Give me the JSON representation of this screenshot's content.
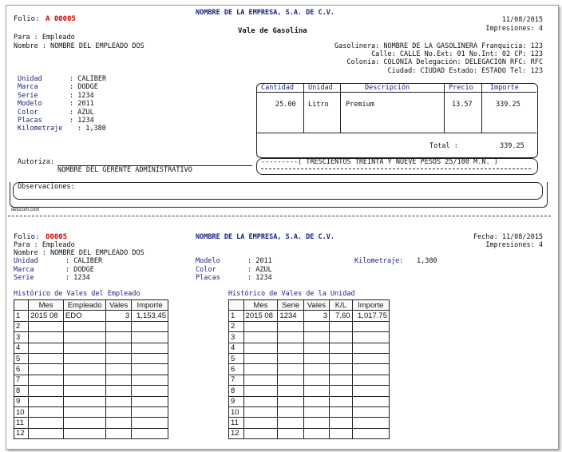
{
  "voucher": {
    "folio_label": "Folio:",
    "folio_value": "A 00005",
    "company": "NOMBRE DE LA EMPRESA, S.A. DE C.V.",
    "title": "Vale de Gasolina",
    "date": "11/08/2015",
    "impressions": "Impresiones: 4",
    "para_label": "Para   : Empleado",
    "nombre_label": "Nombre : NOMBRE DEL EMPLEADO DOS",
    "station": [
      "Gasolinera: NOMBRE DE LA GASOLINERA Franquicia: 123",
      "Calle: CALLE No.Ext: 01 No.Int: 02 CP: 123",
      "Colonia: COLONIA Delegación: DELEGACION  RFC: RFC",
      "Ciudad: CIUDAD Estado: ESTADO Tel: 123"
    ],
    "vehicle": [
      {
        "label": "Unidad",
        "value": ": CALIBER"
      },
      {
        "label": "Marca",
        "value": ": DODGE"
      },
      {
        "label": "Serie",
        "value": ": 1234"
      },
      {
        "label": "Modelo",
        "value": ": 2011"
      },
      {
        "label": "Color",
        "value": ": AZUL"
      },
      {
        "label": "Placas",
        "value": ": 1234"
      },
      {
        "label": "Kilometraje",
        "value": ": 1,380"
      }
    ],
    "items_table": {
      "headers": [
        "Cantidad",
        "Unidad",
        "Descripción",
        "Precio",
        "Importe"
      ],
      "row": [
        "25.00",
        "Litro",
        "Premium",
        "13.57",
        "339.25"
      ],
      "total_label": "Total   :",
      "total_value": "339.25"
    },
    "amount_words": "---------( TRESCIENTOS TREINTA Y NUEVE PESOS 25/100 M.N. )",
    "autoriza_label": "Autoriza:",
    "autoriza_name": "NOMBRE DEL GERENTE ADMINISTRATIVO",
    "observaciones_label": "Observaciones:",
    "footer_brand": "delscom.com"
  },
  "stub": {
    "folio_label": "Folio:",
    "folio_value": "00005",
    "company": "NOMBRE DE LA EMPRESA, S.A. DE C.V.",
    "date": "Fecha: 11/08/2015",
    "impressions": "Impresiones: 4",
    "para_label": "Para   : Empleado",
    "nombre_label": "Nombre : NOMBRE DEL EMPLEADO DOS",
    "col1": [
      {
        "label": "Unidad",
        "value": ": CALIBER"
      },
      {
        "label": "Marca",
        "value": ": DODGE"
      },
      {
        "label": "Serie",
        "value": ": 1234"
      }
    ],
    "col2": [
      {
        "label": "Modelo",
        "value": ": 2011"
      },
      {
        "label": "Color",
        "value": ": AZUL"
      },
      {
        "label": "Placas",
        "value": ": 1234"
      }
    ],
    "km_label": "Kilometraje:",
    "km_value": "1,380",
    "hist_employee": {
      "title": "Histórico de Vales del Empleado",
      "headers": [
        "",
        "Mes",
        "Empleado",
        "Vales",
        "Importe"
      ],
      "rows": [
        [
          "1",
          "2015 08",
          "EDO",
          "3",
          "1,153.45"
        ],
        [
          "2",
          "",
          "",
          "",
          ""
        ],
        [
          "3",
          "",
          "",
          "",
          ""
        ],
        [
          "4",
          "",
          "",
          "",
          ""
        ],
        [
          "5",
          "",
          "",
          "",
          ""
        ],
        [
          "6",
          "",
          "",
          "",
          ""
        ],
        [
          "7",
          "",
          "",
          "",
          ""
        ],
        [
          "8",
          "",
          "",
          "",
          ""
        ],
        [
          "9",
          "",
          "",
          "",
          ""
        ],
        [
          "10",
          "",
          "",
          "",
          ""
        ],
        [
          "11",
          "",
          "",
          "",
          ""
        ],
        [
          "12",
          "",
          "",
          "",
          ""
        ]
      ]
    },
    "hist_unit": {
      "title": "Histórico de Vales de la Unidad",
      "headers": [
        "",
        "Mes",
        "Serie",
        "Vales",
        "K/L",
        "Importe"
      ],
      "rows": [
        [
          "1",
          "2015 08",
          "1234",
          "3",
          "7.60",
          "1,017.75"
        ],
        [
          "2",
          "",
          "",
          "",
          "",
          ""
        ],
        [
          "3",
          "",
          "",
          "",
          "",
          ""
        ],
        [
          "4",
          "",
          "",
          "",
          "",
          ""
        ],
        [
          "5",
          "",
          "",
          "",
          "",
          ""
        ],
        [
          "6",
          "",
          "",
          "",
          "",
          ""
        ],
        [
          "7",
          "",
          "",
          "",
          "",
          ""
        ],
        [
          "8",
          "",
          "",
          "",
          "",
          ""
        ],
        [
          "9",
          "",
          "",
          "",
          "",
          ""
        ],
        [
          "10",
          "",
          "",
          "",
          "",
          ""
        ],
        [
          "11",
          "",
          "",
          "",
          "",
          ""
        ],
        [
          "12",
          "",
          "",
          "",
          "",
          ""
        ]
      ]
    }
  }
}
